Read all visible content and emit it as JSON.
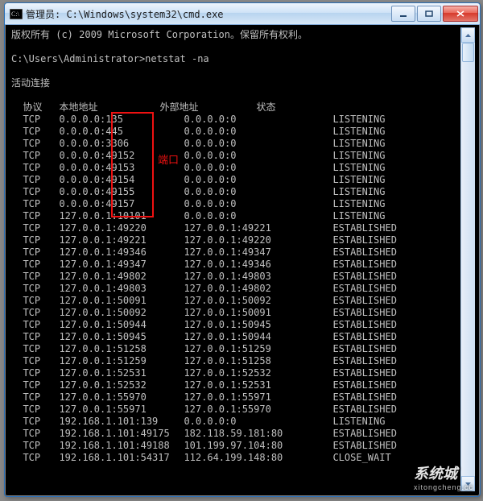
{
  "window": {
    "title": "管理员: C:\\Windows\\system32\\cmd.exe",
    "min_tip": "Minimize",
    "max_tip": "Maximize",
    "close_tip": "Close"
  },
  "term": {
    "copyright": "版权所有 (c) 2009 Microsoft Corporation。保留所有权利。",
    "prompt": "C:\\Users\\Administrator>netstat -na",
    "heading": "活动连接",
    "columns": {
      "proto": "协议",
      "local": "本地地址",
      "foreign": "外部地址",
      "state": "状态"
    },
    "rows": [
      {
        "proto": "TCP",
        "local": "0.0.0.0:135",
        "foreign": "0.0.0.0:0",
        "state": "LISTENING"
      },
      {
        "proto": "TCP",
        "local": "0.0.0.0:445",
        "foreign": "0.0.0.0:0",
        "state": "LISTENING"
      },
      {
        "proto": "TCP",
        "local": "0.0.0.0:3306",
        "foreign": "0.0.0.0:0",
        "state": "LISTENING"
      },
      {
        "proto": "TCP",
        "local": "0.0.0.0:49152",
        "foreign": "0.0.0.0:0",
        "state": "LISTENING"
      },
      {
        "proto": "TCP",
        "local": "0.0.0.0:49153",
        "foreign": "0.0.0.0:0",
        "state": "LISTENING"
      },
      {
        "proto": "TCP",
        "local": "0.0.0.0:49154",
        "foreign": "0.0.0.0:0",
        "state": "LISTENING"
      },
      {
        "proto": "TCP",
        "local": "0.0.0.0:49155",
        "foreign": "0.0.0.0:0",
        "state": "LISTENING"
      },
      {
        "proto": "TCP",
        "local": "0.0.0.0:49157",
        "foreign": "0.0.0.0:0",
        "state": "LISTENING"
      },
      {
        "proto": "TCP",
        "local": "127.0.0.1:10101",
        "foreign": "0.0.0.0:0",
        "state": "LISTENING"
      },
      {
        "proto": "TCP",
        "local": "127.0.0.1:49220",
        "foreign": "127.0.0.1:49221",
        "state": "ESTABLISHED"
      },
      {
        "proto": "TCP",
        "local": "127.0.0.1:49221",
        "foreign": "127.0.0.1:49220",
        "state": "ESTABLISHED"
      },
      {
        "proto": "TCP",
        "local": "127.0.0.1:49346",
        "foreign": "127.0.0.1:49347",
        "state": "ESTABLISHED"
      },
      {
        "proto": "TCP",
        "local": "127.0.0.1:49347",
        "foreign": "127.0.0.1:49346",
        "state": "ESTABLISHED"
      },
      {
        "proto": "TCP",
        "local": "127.0.0.1:49802",
        "foreign": "127.0.0.1:49803",
        "state": "ESTABLISHED"
      },
      {
        "proto": "TCP",
        "local": "127.0.0.1:49803",
        "foreign": "127.0.0.1:49802",
        "state": "ESTABLISHED"
      },
      {
        "proto": "TCP",
        "local": "127.0.0.1:50091",
        "foreign": "127.0.0.1:50092",
        "state": "ESTABLISHED"
      },
      {
        "proto": "TCP",
        "local": "127.0.0.1:50092",
        "foreign": "127.0.0.1:50091",
        "state": "ESTABLISHED"
      },
      {
        "proto": "TCP",
        "local": "127.0.0.1:50944",
        "foreign": "127.0.0.1:50945",
        "state": "ESTABLISHED"
      },
      {
        "proto": "TCP",
        "local": "127.0.0.1:50945",
        "foreign": "127.0.0.1:50944",
        "state": "ESTABLISHED"
      },
      {
        "proto": "TCP",
        "local": "127.0.0.1:51258",
        "foreign": "127.0.0.1:51259",
        "state": "ESTABLISHED"
      },
      {
        "proto": "TCP",
        "local": "127.0.0.1:51259",
        "foreign": "127.0.0.1:51258",
        "state": "ESTABLISHED"
      },
      {
        "proto": "TCP",
        "local": "127.0.0.1:52531",
        "foreign": "127.0.0.1:52532",
        "state": "ESTABLISHED"
      },
      {
        "proto": "TCP",
        "local": "127.0.0.1:52532",
        "foreign": "127.0.0.1:52531",
        "state": "ESTABLISHED"
      },
      {
        "proto": "TCP",
        "local": "127.0.0.1:55970",
        "foreign": "127.0.0.1:55971",
        "state": "ESTABLISHED"
      },
      {
        "proto": "TCP",
        "local": "127.0.0.1:55971",
        "foreign": "127.0.0.1:55970",
        "state": "ESTABLISHED"
      },
      {
        "proto": "TCP",
        "local": "192.168.1.101:139",
        "foreign": "0.0.0.0:0",
        "state": "LISTENING"
      },
      {
        "proto": "TCP",
        "local": "192.168.1.101:49175",
        "foreign": "182.118.59.181:80",
        "state": "ESTABLISHED"
      },
      {
        "proto": "TCP",
        "local": "192.168.1.101:49188",
        "foreign": "101.199.97.104:80",
        "state": "ESTABLISHED"
      },
      {
        "proto": "TCP",
        "local": "192.168.1.101:54317",
        "foreign": "112.64.199.148:80",
        "state": "CLOSE_WAIT"
      }
    ]
  },
  "annotation": {
    "port_label": "端口"
  },
  "watermark": {
    "brand": "系统城",
    "url": "xitongcheng.cc"
  }
}
